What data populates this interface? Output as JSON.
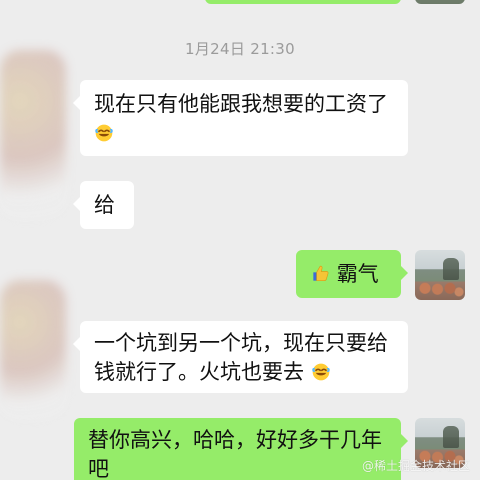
{
  "timestamp": "1月24日 21:30",
  "messages": [
    {
      "text": "现在只有他能跟我想要的工资了",
      "emoji": "laughing-face-emoji"
    },
    {
      "text": "给"
    },
    {
      "text": "霸气",
      "emoji": "thumbs-up-emoji"
    },
    {
      "line1": "一个坑到另一个坑，现在只要给",
      "line2": "钱就行了。火坑也要去",
      "emoji": "laughing-face-emoji"
    },
    {
      "line1": "替你高兴，哈哈，好好多干几年",
      "line2": "吧"
    }
  ],
  "watermark": "@稀土掘金技术社区",
  "colors": {
    "background": "#ededed",
    "left_bubble": "#ffffff",
    "right_bubble": "#95ec69",
    "timestamp": "#9b9b9b"
  }
}
